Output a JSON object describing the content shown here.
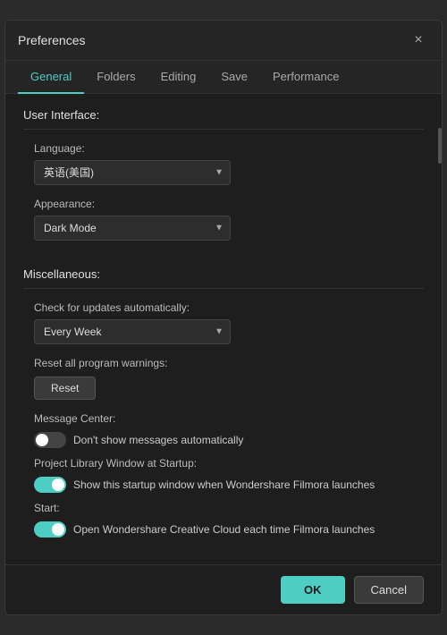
{
  "dialog": {
    "title": "Preferences",
    "close_label": "×"
  },
  "tabs": {
    "items": [
      {
        "id": "general",
        "label": "General",
        "active": true
      },
      {
        "id": "folders",
        "label": "Folders",
        "active": false
      },
      {
        "id": "editing",
        "label": "Editing",
        "active": false
      },
      {
        "id": "save",
        "label": "Save",
        "active": false
      },
      {
        "id": "performance",
        "label": "Performance",
        "active": false
      }
    ]
  },
  "sections": {
    "user_interface": {
      "header": "User Interface:",
      "language_label": "Language:",
      "language_value": "英语(美国)",
      "appearance_label": "Appearance:",
      "appearance_value": "Dark Mode"
    },
    "miscellaneous": {
      "header": "Miscellaneous:",
      "updates_label": "Check for updates automatically:",
      "updates_value": "Every Week",
      "reset_label": "Reset all program warnings:",
      "reset_button": "Reset",
      "message_center_label": "Message Center:",
      "message_toggle_label": "Don't show messages automatically",
      "project_library_label": "Project Library Window at Startup:",
      "project_toggle_label": "Show this startup window when Wondershare Filmora launches",
      "start_label": "Start:",
      "start_toggle_label": "Open Wondershare Creative Cloud each time Filmora launches"
    }
  },
  "footer": {
    "ok_label": "OK",
    "cancel_label": "Cancel"
  }
}
